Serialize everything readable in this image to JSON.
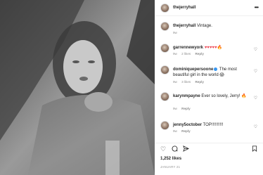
{
  "post": {
    "username": "thejerryhall",
    "caption": "Vintage.",
    "caption_time": "9w",
    "likes": "1,252 likes",
    "date": "JANUARY 21"
  },
  "comments": [
    {
      "username": "garrennewyork",
      "text": "♥♥♥♥♥",
      "emoji": "🔥",
      "time": "9w",
      "likes": "2 likes",
      "reply": "Reply"
    },
    {
      "username": "dominiquepersoone",
      "text": "The most beautiful girl in the world",
      "emoji": "😱",
      "time": "9w",
      "likes": "3 likes",
      "reply": "Reply"
    },
    {
      "username": "karynmpayne",
      "text": "Ever so lovely, Jerry!",
      "emoji": "🔥",
      "time": "9w",
      "likes": "",
      "reply": "Reply"
    },
    {
      "username": "jenny5october",
      "text": "TOP!!!!!!!!!!",
      "emoji": "",
      "time": "9w",
      "likes": "",
      "reply": "Reply"
    }
  ],
  "icons": {
    "more": "more-horizontal-icon",
    "heart": "heart-outline-icon",
    "comment": "comment-icon",
    "share": "share-icon",
    "save": "bookmark-icon"
  },
  "colors": {
    "accent_heart": "#ed4956",
    "verified": "#3897f0",
    "meta": "#8e8e8e"
  }
}
